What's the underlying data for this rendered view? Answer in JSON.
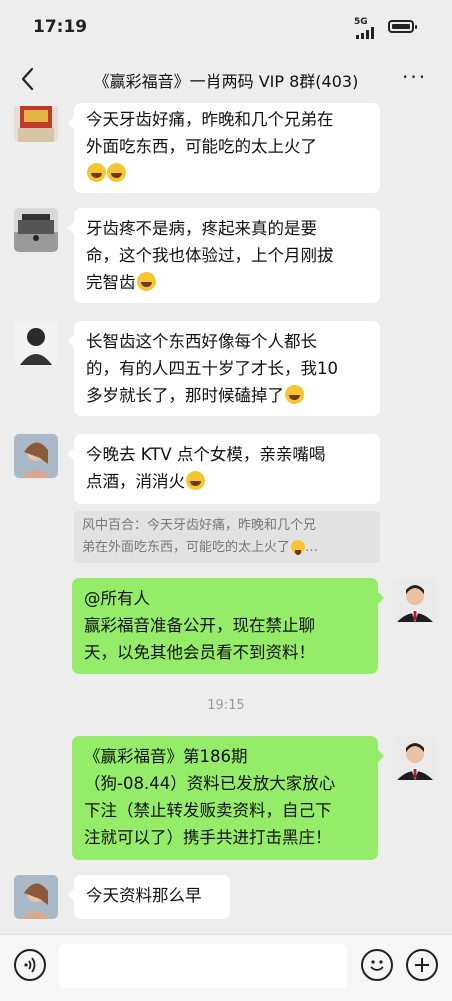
{
  "status_bar": {
    "time": "17:19",
    "network": "5G"
  },
  "header": {
    "title": "《赢彩福音》一肖两码 VIP 8群(403)"
  },
  "messages": [
    {
      "side": "in",
      "lines": [
        "今天牙齿好痛，昨晚和几个兄弟在",
        "外面吃东西，可能吃的太上火了"
      ]
    },
    {
      "side": "in",
      "lines": [
        "牙齿疼不是病，疼起来真的是要",
        "命，这个我也体验过，上个月刚拔",
        "完智齿"
      ]
    },
    {
      "side": "in",
      "lines": [
        "长智齿这个东西好像每个人都长",
        "的，有的人四五十岁了才长，我10",
        "多岁就长了，那时候磕掉了"
      ]
    },
    {
      "side": "in",
      "lines": [
        "今晚去 KTV 点个女模，亲亲嘴喝",
        "点酒，消消火"
      ]
    },
    {
      "side": "out",
      "lines": [
        "@所有人",
        "赢彩福音准备公开，现在禁止聊",
        "天，以免其他会员看不到资料！"
      ]
    },
    {
      "side": "out",
      "lines": [
        "《赢彩福音》第186期",
        "（狗-08.44）资料已发放大家放心",
        "下注（禁止转发贩卖资料，自己下",
        "注就可以了）携手共进打击黑庄！"
      ]
    },
    {
      "side": "in",
      "lines": [
        "今天资料那么早"
      ]
    }
  ],
  "quote": {
    "lines": [
      "风中百合：今天牙齿好痛，昨晚和几个兄",
      "弟在外面吃东西，可能吃的太上火了"
    ],
    "ellipsis": "…"
  },
  "timestamp": "19:15",
  "input_bar": {
    "voice_icon": "voice-icon",
    "emoji_icon": "emoji-icon",
    "add_icon": "plus-icon",
    "text_value": ""
  }
}
